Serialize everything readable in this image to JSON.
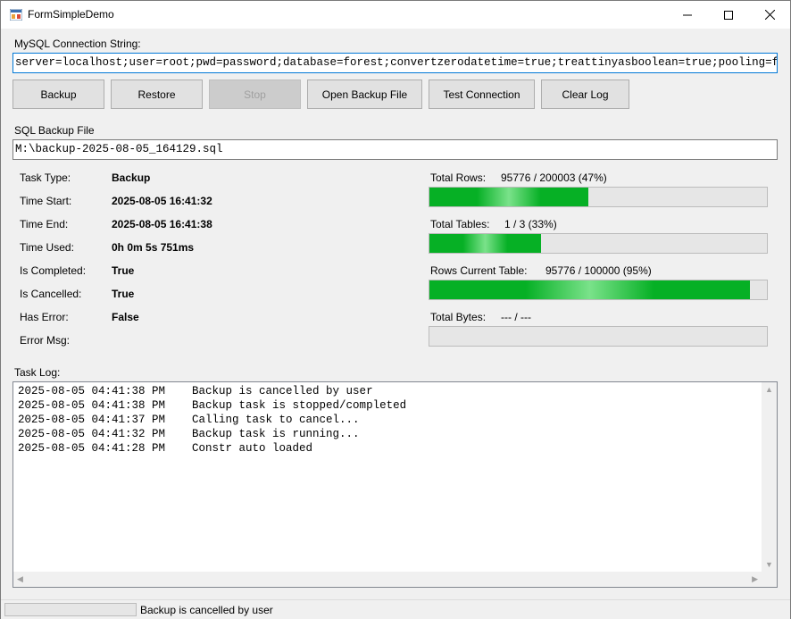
{
  "window": {
    "title": "FormSimpleDemo"
  },
  "connection": {
    "label": "MySQL Connection String:",
    "value": "server=localhost;user=root;pwd=password;database=forest;convertzerodatetime=true;treattinyasboolean=true;pooling=false"
  },
  "buttons": {
    "backup": "Backup",
    "restore": "Restore",
    "stop": "Stop",
    "open_backup": "Open Backup File",
    "test_connection": "Test Connection",
    "clear_log": "Clear Log"
  },
  "backup_file": {
    "label": "SQL Backup File",
    "value": "M:\\backup-2025-08-05_164129.sql"
  },
  "info": [
    {
      "label": "Task Type:",
      "value": "Backup"
    },
    {
      "label": "Time Start:",
      "value": "2025-08-05 16:41:32"
    },
    {
      "label": "Time End:",
      "value": "2025-08-05 16:41:38"
    },
    {
      "label": "Time Used:",
      "value": "0h 0m 5s 751ms"
    },
    {
      "label": "Is Completed:",
      "value": "True"
    },
    {
      "label": "Is Cancelled:",
      "value": "True"
    },
    {
      "label": "Has Error:",
      "value": "False"
    },
    {
      "label": "Error Msg:",
      "value": ""
    }
  ],
  "progress": [
    {
      "label": "Total Rows:",
      "value": "95776 / 200003 (47%)",
      "fraction": 0.47
    },
    {
      "label": "Total Tables:",
      "value": "1 / 3 (33%)",
      "fraction": 0.33
    },
    {
      "label": "Rows Current Table:",
      "value": "95776 / 100000 (95%)",
      "fraction": 0.95
    },
    {
      "label": "Total Bytes:",
      "value": "--- / ---",
      "fraction": 0
    }
  ],
  "log": {
    "label": "Task Log:",
    "lines": [
      "2025-08-05 04:41:38 PM    Backup is cancelled by user",
      "2025-08-05 04:41:38 PM    Backup task is stopped/completed",
      "2025-08-05 04:41:37 PM    Calling task to cancel...",
      "2025-08-05 04:41:32 PM    Backup task is running...",
      "2025-08-05 04:41:28 PM    Constr auto loaded"
    ]
  },
  "status": {
    "text": "Backup is cancelled by user",
    "progress": 0
  },
  "icons": {
    "app": "app-icon",
    "minimize": "minimize-icon",
    "maximize": "maximize-icon",
    "close": "close-icon"
  }
}
